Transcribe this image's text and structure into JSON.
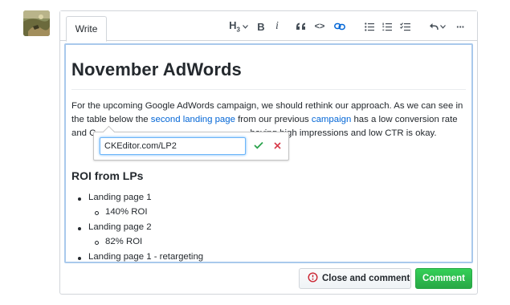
{
  "tabs": {
    "write_label": "Write"
  },
  "toolbar": {
    "heading_label": "H",
    "heading_sub": "3",
    "bold_label": "B",
    "italic_label": "i",
    "code_label": "<>",
    "more_label": "···",
    "icons": [
      "heading-icon",
      "bold-icon",
      "italic-icon",
      "blockquote-icon",
      "code-icon",
      "link-icon",
      "bulleted-list-icon",
      "numbered-list-icon",
      "todo-list-icon",
      "undo-icon",
      "more-icon"
    ]
  },
  "editor": {
    "title": "November AdWords",
    "paragraph": {
      "text1": "For the upcoming Google AdWords campaign, we should rethink our approach. As we can see in the table below the ",
      "link1": "second landing page",
      "text2": " from our previous ",
      "link2": "campaign",
      "text3": " has a low conversion rate and C",
      "text4": "having high impressions and low CTR is okay."
    },
    "subheading": "ROI from LPs",
    "list": [
      {
        "label": "Landing page 1",
        "sub": "140% ROI"
      },
      {
        "label": "Landing page 2",
        "sub": "82% ROI"
      },
      {
        "label": "Landing page 1 - retargeting"
      }
    ],
    "link_balloon": {
      "url_value": "CKEditor.com/LP2"
    }
  },
  "actions": {
    "close_label": "Close and comment",
    "comment_label": "Comment"
  },
  "colors": {
    "link": "#0366d6",
    "save_check": "#2da44e",
    "cancel_x": "#d73a49",
    "comment_green": "#28a745",
    "focus_border": "#a9c9ec"
  }
}
